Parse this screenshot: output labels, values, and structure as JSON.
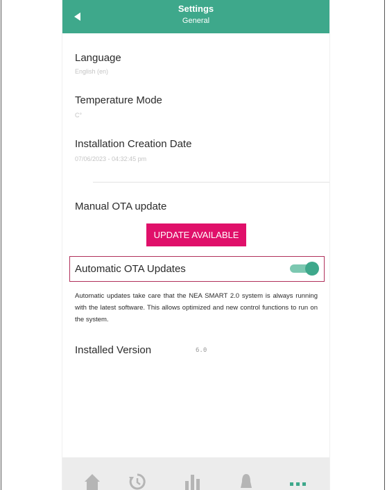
{
  "header": {
    "title": "Settings",
    "subtitle": "General",
    "back_icon": "back-arrow-icon"
  },
  "settings": {
    "language": {
      "label": "Language",
      "value": "English (en)"
    },
    "temperature_mode": {
      "label": "Temperature Mode",
      "value": "C°"
    },
    "installation_date": {
      "label": "Installation Creation Date",
      "value": "07/06/2023 - 04:32:45 pm"
    },
    "manual_ota": {
      "label": "Manual OTA update",
      "button_label": "UPDATE AVAILABLE"
    },
    "automatic_ota": {
      "label": "Automatic OTA Updates",
      "enabled": true
    },
    "description": "Automatic updates take care that the NEA SMART 2.0 system is always running with the latest software. This allows optimized and new control functions to run on the system.",
    "installed_version": {
      "label": "Installed Version",
      "value": "6.0"
    }
  },
  "bottom_nav": {
    "items": [
      {
        "icon": "home-icon",
        "active": false
      },
      {
        "icon": "history-icon",
        "active": false
      },
      {
        "icon": "statistics-icon",
        "active": false
      },
      {
        "icon": "bell-icon",
        "active": false
      },
      {
        "icon": "more-icon",
        "active": true
      }
    ]
  },
  "colors": {
    "primary": "#3ea88b",
    "accent": "#e0106a",
    "highlight_border": "#b0305a",
    "nav_background": "#ececec"
  }
}
